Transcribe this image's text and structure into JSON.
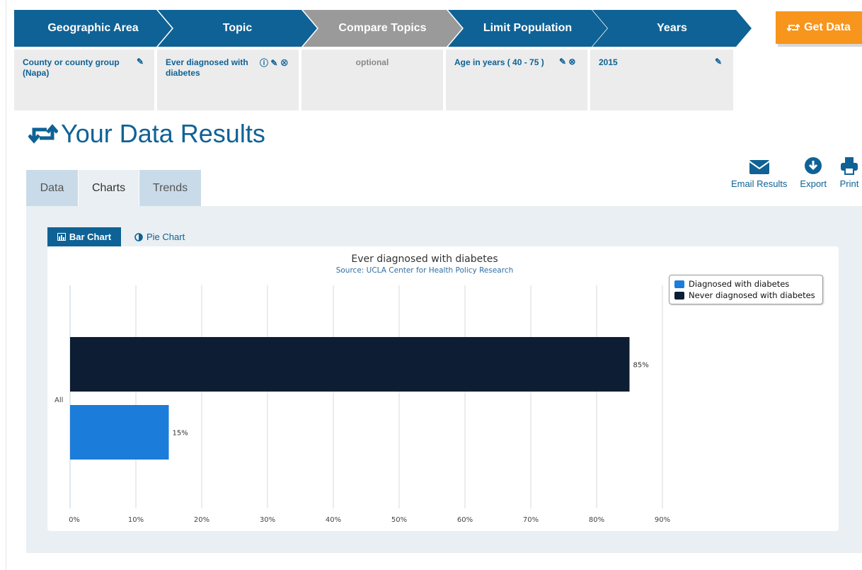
{
  "steps": [
    {
      "label": "Geographic Area",
      "state": "blue"
    },
    {
      "label": "Topic",
      "state": "blue"
    },
    {
      "label": "Compare Topics",
      "state": "gray"
    },
    {
      "label": "Limit Population",
      "state": "blue"
    },
    {
      "label": "Years",
      "state": "blue"
    }
  ],
  "get_data": {
    "label": "Get Data"
  },
  "selections": {
    "geo": "County or county group (Napa)",
    "topic": "Ever diagnosed with diabetes",
    "compare": "optional",
    "population": "Age in years ( 40 - 75 )",
    "years": "2015"
  },
  "page_title": "Your Data Results",
  "tabs": [
    {
      "label": "Data"
    },
    {
      "label": "Charts"
    },
    {
      "label": "Trends"
    }
  ],
  "actions": {
    "email": "Email Results",
    "export": "Export",
    "print": "Print"
  },
  "chart_types": {
    "bar": "Bar Chart",
    "pie": "Pie Chart"
  },
  "colors": {
    "accent": "#0f6295",
    "orange": "#f7951d",
    "diagnosed": "#1c7cd9",
    "never": "#0d1d33"
  },
  "chart_data": {
    "type": "bar",
    "orientation": "horizontal",
    "title": "Ever diagnosed with diabetes",
    "subtitle": "Source: UCLA Center for Health Policy Research",
    "categories": [
      "All"
    ],
    "series": [
      {
        "name": "Never diagnosed with diabetes",
        "values": [
          85
        ],
        "label": "85%",
        "color": "#0d1d33"
      },
      {
        "name": "Diagnosed with diabetes",
        "values": [
          15
        ],
        "label": "15%",
        "color": "#1c7cd9"
      }
    ],
    "xlim": [
      0,
      90
    ],
    "xticks": [
      "0%",
      "10%",
      "20%",
      "30%",
      "40%",
      "50%",
      "60%",
      "70%",
      "80%",
      "90%"
    ],
    "grid": true,
    "legend_position": "top-right",
    "legend": [
      "Diagnosed with diabetes",
      "Never diagnosed with diabetes"
    ]
  }
}
